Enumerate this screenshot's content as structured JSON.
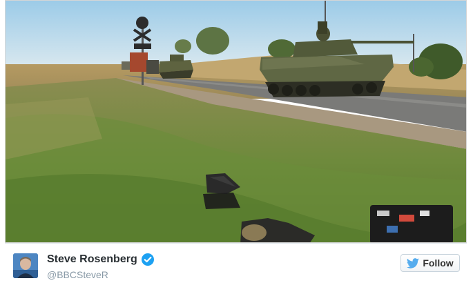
{
  "tweet": {
    "author": {
      "display_name": "Steve Rosenberg",
      "handle": "@BBCSteveR",
      "verified": true,
      "avatar": "avatar-photo"
    },
    "follow_button": {
      "label": "Follow",
      "icon": "twitter-bird-icon"
    },
    "photo": {
      "content": "photo"
    }
  },
  "colors": {
    "twitter_blue": "#55acee",
    "verified_blue": "#1da1f2",
    "name_text": "#292f33",
    "handle_text": "#8899a6"
  }
}
